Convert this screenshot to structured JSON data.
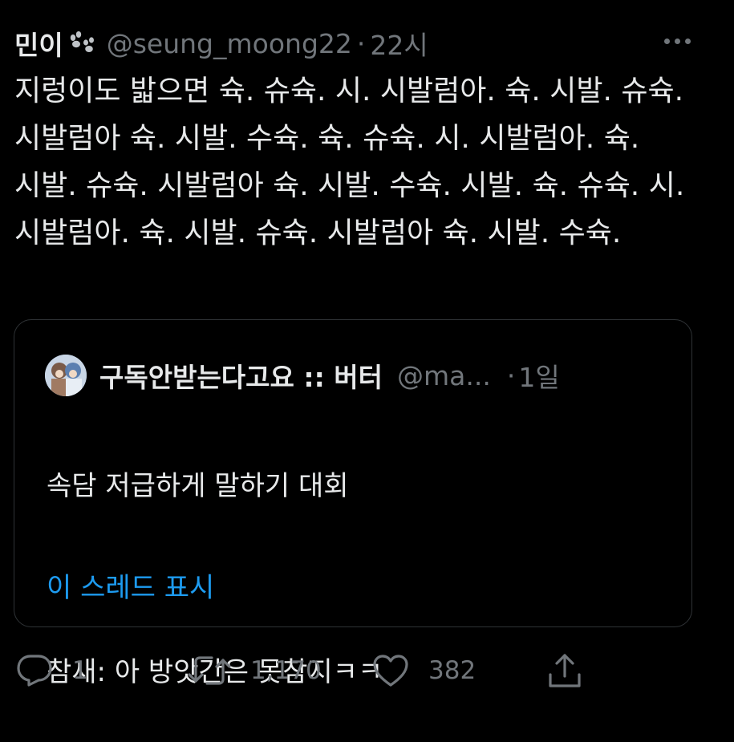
{
  "tweet": {
    "display_name": "민이",
    "handle": "@seung_moong22",
    "separator": "·",
    "time": "22시",
    "text": "지렁이도 밟으면 슉. 슈슉. 시. 시발럼아. 슉. 시발. 슈슉. 시발럼아 슉. 시발. 수슉. 슉. 슈슉. 시. 시발럼아. 슉. 시발. 슈슉. 시발럼아 슉. 시발. 수슉. 시발. 슉. 슈슉. 시. 시발럼아. 슉. 시발. 슈슉. 시발럼아 슉. 시발. 수슉."
  },
  "quote": {
    "display_name": "구독안받는다고요 :: 버터",
    "handle": "@ma...",
    "separator": "·",
    "time": "1일",
    "line1": "속담 저급하게 말하기 대회",
    "line2": "참새: 아 방앗간은 못참지ㅋㅋ",
    "show_thread": "이 스레드 표시"
  },
  "actions": {
    "reply_count": "1",
    "retweet_count": "1,170",
    "like_count": "382"
  },
  "icons": [
    "paw-icon",
    "more-icon",
    "reply-icon",
    "retweet-icon",
    "like-icon",
    "share-icon"
  ],
  "colors": {
    "background": "#000000",
    "text": "#e7e9ea",
    "secondary": "#71767b",
    "link": "#1d9bf0",
    "border": "#2f3336"
  }
}
